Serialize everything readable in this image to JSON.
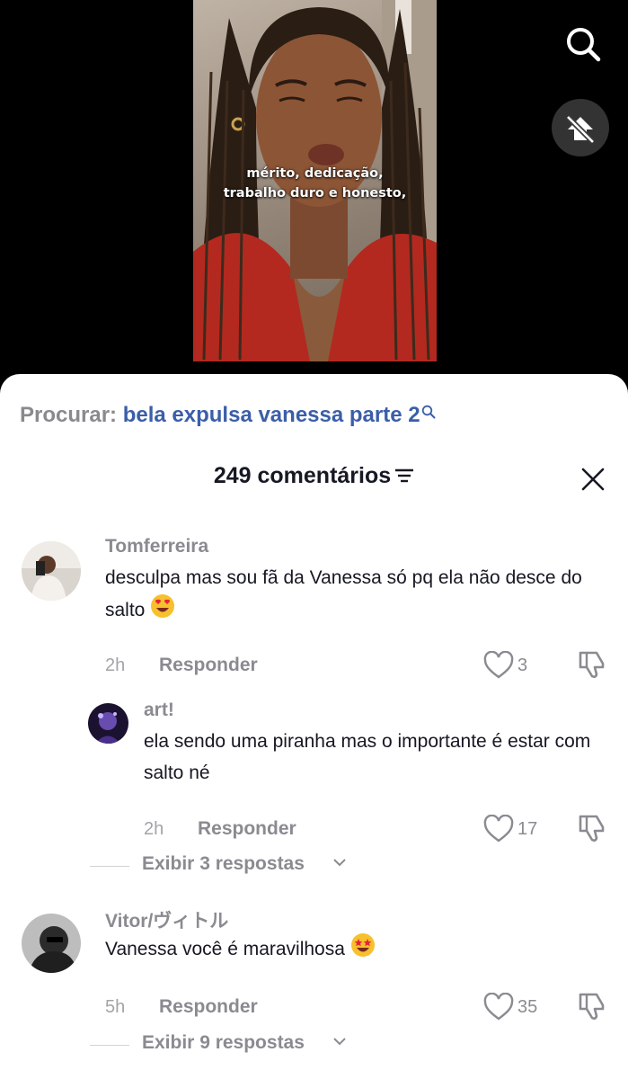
{
  "video": {
    "caption_line1": "mérito, dedicação,",
    "caption_line2": "trabalho duro e honesto,"
  },
  "top_actions": {
    "search_icon": "search-icon",
    "repost_icon": "not-interested-icon"
  },
  "search_suggestion": {
    "label": "Procurar:",
    "query": "bela expulsa vanessa parte 2"
  },
  "comments_header": {
    "title": "249 comentários",
    "sort_icon": "sort-icon",
    "close_icon": "close-icon"
  },
  "comments": [
    {
      "username": "Tomferreira",
      "text": "desculpa mas sou fã da Vanessa só pq ela não desce do salto",
      "emoji": "heart-eyes-emoji",
      "time": "2h",
      "reply_label": "Responder",
      "likes": "3"
    },
    {
      "username": "art!",
      "text": "ela sendo uma piranha mas o importante é estar com salto né",
      "time": "2h",
      "reply_label": "Responder",
      "likes": "17",
      "is_reply": true
    },
    {
      "username": "Vitor/ヴィトル",
      "text": "Vanessa você é maravilhosa",
      "emoji": "star-struck-emoji",
      "time": "5h",
      "reply_label": "Responder",
      "likes": "35"
    }
  ],
  "view_replies": [
    {
      "label": "Exibir 3 respostas"
    },
    {
      "label": "Exibir 9 respostas"
    }
  ],
  "colors": {
    "link_blue": "#3b5ea8",
    "muted_gray": "#8a8b91",
    "text_dark": "#161823",
    "emoji_yellow": "#f7c02d"
  }
}
